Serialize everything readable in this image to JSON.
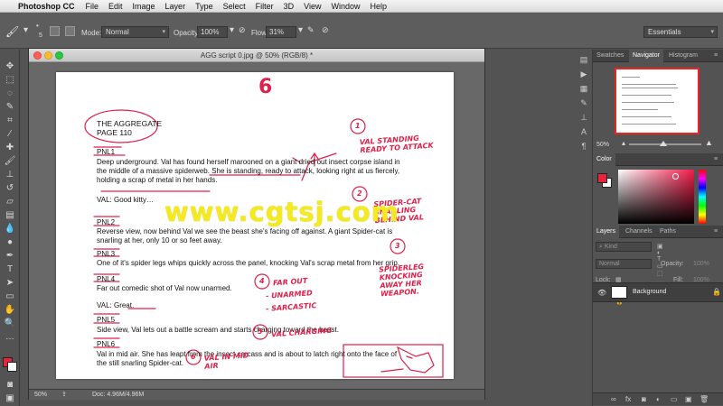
{
  "menubar": {
    "app": "Photoshop CC",
    "items": [
      "File",
      "Edit",
      "Image",
      "Layer",
      "Type",
      "Select",
      "Filter",
      "3D",
      "View",
      "Window",
      "Help"
    ]
  },
  "options": {
    "brush_size": "5",
    "mode_label": "Mode:",
    "mode_value": "Normal",
    "opacity_label": "Opacity:",
    "opacity_value": "100%",
    "flow_label": "Flow:",
    "flow_value": "31%",
    "workspace": "Essentials"
  },
  "document": {
    "title": "AGG script 0.jpg @ 50% (RGB/8) *",
    "zoom": "50%",
    "doc_size": "Doc: 4.96M/4.96M"
  },
  "script": {
    "heading1": "THE AGGREGATE",
    "heading2": "PAGE 110",
    "pnl1": "PNL1",
    "pnl1_l1": "Deep underground. Val has found herself marooned on a giant dried out insect corpse island in",
    "pnl1_l2": "the middle of a massive spiderweb. She is standing, ready to attack, looking right at us fiercely,",
    "pnl1_l3": "holding a scrap of metal in her hands.",
    "val1": "VAL: Good kitty…",
    "pnl2": "PNL2",
    "pnl2_l1": "Reverse view, now behind Val we see the beast she's facing off against. A giant Spider-cat is",
    "pnl2_l2": "snarling at her, only 10 or so feet away.",
    "pnl3": "PNL3",
    "pnl3_l1": "One of it's spider legs whips quickly across the panel, knocking Val's scrap metal from her grip.",
    "pnl4": "PNL4",
    "pnl4_l1": "Far out comedic shot of Val now unarmed.",
    "val2": "VAL: Great.",
    "pnl5": "PNL5",
    "pnl5_l1": "Side view, Val lets out a battle scream and starts charging toward the beast.",
    "pnl6": "PNL6",
    "pnl6_l1": "Val in mid air. She has leapt from the insect carcass and is about to latch right onto the face of",
    "pnl6_l2": "the still snarling Spider-cat."
  },
  "annotations": {
    "page_num": "6",
    "n1": "1",
    "a1": "VAL STANDING READY TO ATTACK",
    "n2": "2",
    "a2": "SPIDER-CAT SNARLING BEHIND VAL",
    "n3": "3",
    "a3": "SPIDERLEG KNOCKING AWAY HER WEAPON.",
    "n4": "4",
    "a4a": "FAR OUT",
    "a4b": "- UNARMED",
    "a4c": "- SARCASTIC",
    "n5": "5",
    "a5": "VAL CHARGING",
    "n6": "6",
    "a6": "VAL IN MID AIR"
  },
  "watermark": "www.cgtsj.com",
  "panels": {
    "tab_swatches": "Swatches",
    "tab_navigator": "Navigator",
    "tab_histogram": "Histogram",
    "nav_zoom": "50%",
    "tab_color": "Color",
    "tab_layers": "Layers",
    "tab_channels": "Channels",
    "tab_paths": "Paths",
    "kind": "Kind",
    "blend": "Normal",
    "opacity_label": "Opacity:",
    "opacity": "100%",
    "lock_label": "Lock:",
    "fill_label": "Fill:",
    "fill": "100%",
    "layer_name": "Background"
  },
  "colors": {
    "foreground": "#e8233b",
    "background": "#ffffff",
    "annotation": "#e0204a",
    "watermark": "#f4ea1d"
  }
}
